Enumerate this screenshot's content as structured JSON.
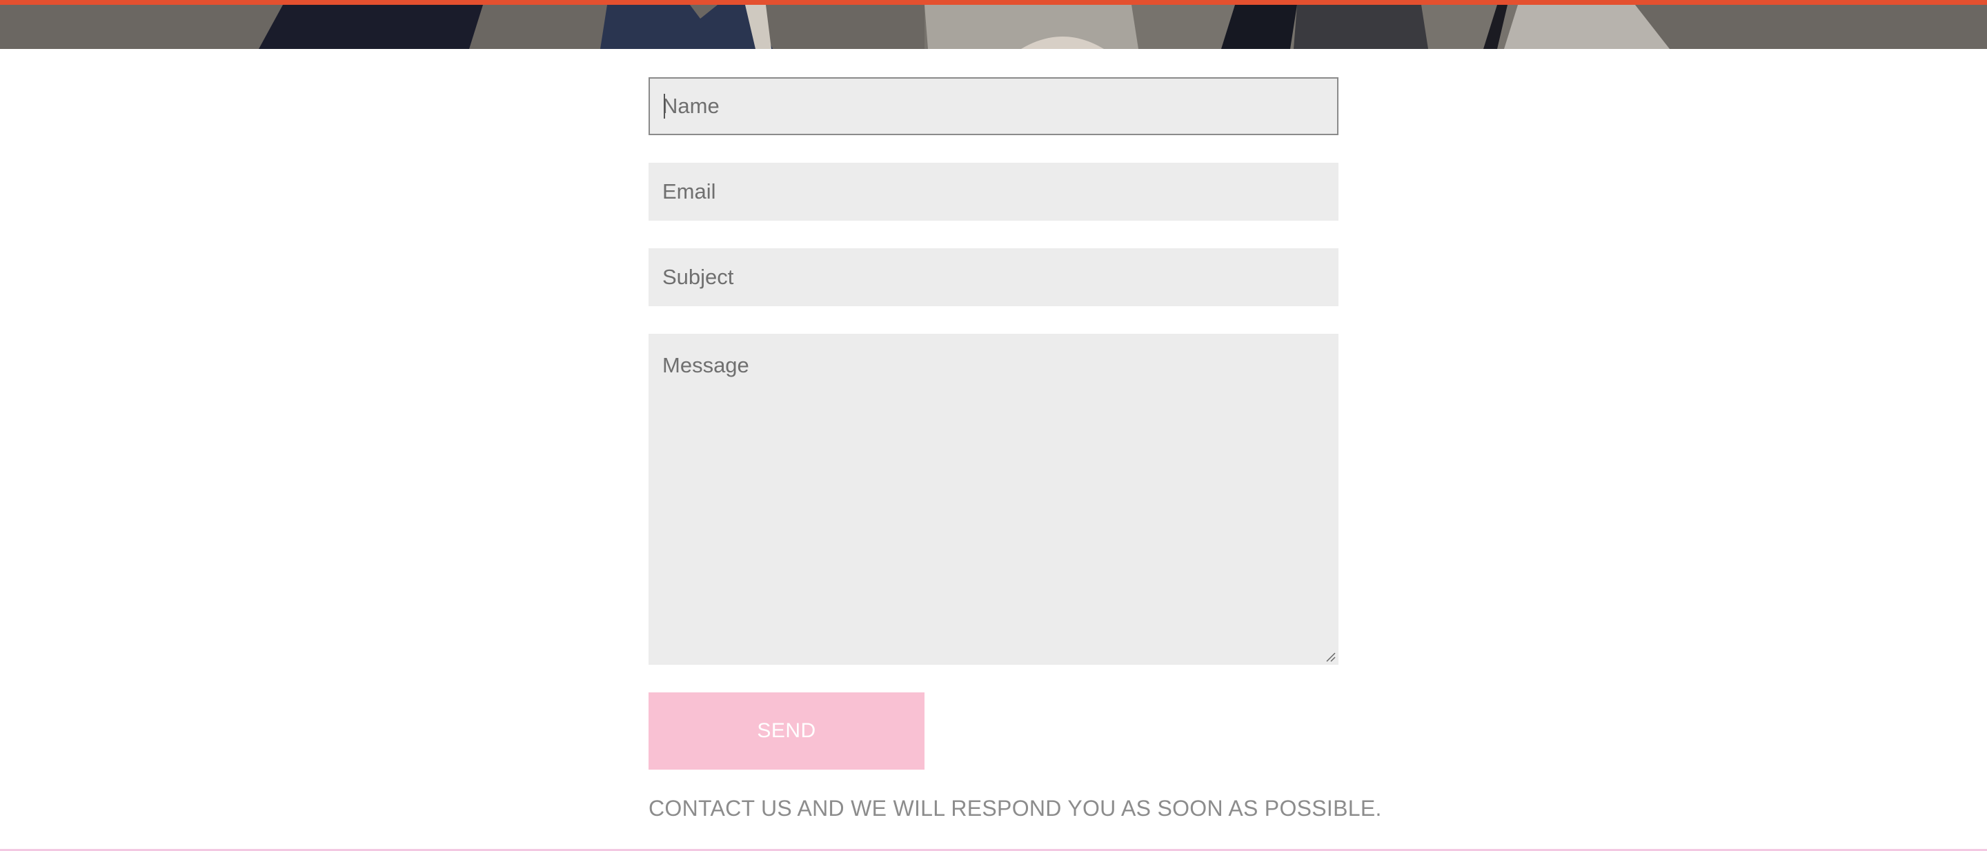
{
  "colors": {
    "accent_bar": "#e4502f",
    "send_button": "#f9c1d3",
    "field_background": "#ececec",
    "note_text": "#8c8c8c"
  },
  "hero": {
    "image": "photo of people (partially visible)"
  },
  "form": {
    "name": {
      "placeholder": "Name",
      "value": ""
    },
    "email": {
      "placeholder": "Email",
      "value": ""
    },
    "subject": {
      "placeholder": "Subject",
      "value": ""
    },
    "message": {
      "placeholder": "Message",
      "value": ""
    },
    "send_label": "SEND"
  },
  "note": "CONTACT US AND WE WILL RESPOND YOU AS SOON AS POSSIBLE."
}
